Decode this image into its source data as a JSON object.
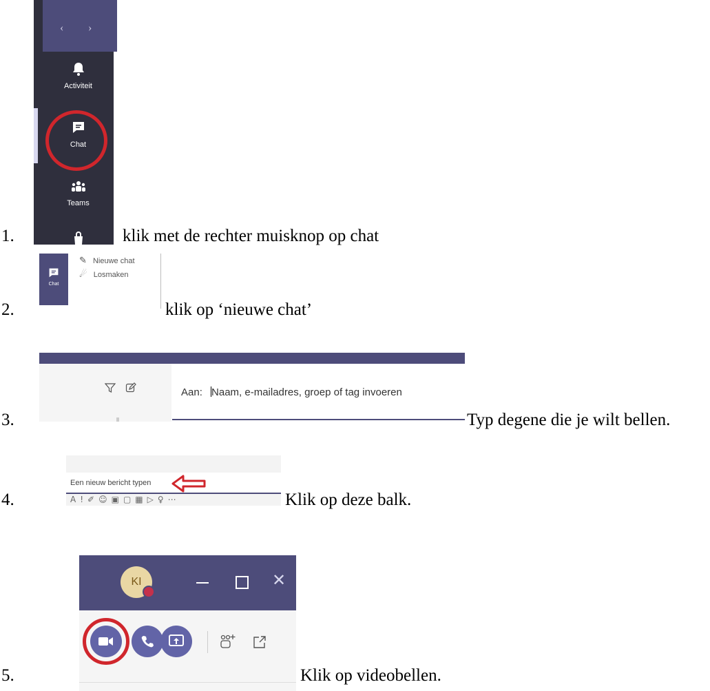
{
  "steps": [
    {
      "number": "1.",
      "text": "klik met de rechter muisknop op chat"
    },
    {
      "number": "2.",
      "text": "klik op ‘nieuwe chat’"
    },
    {
      "number": "3.",
      "text": "Typ degene die je wilt bellen."
    },
    {
      "number": "4.",
      "text": "Klik op deze balk."
    },
    {
      "number": "5.",
      "text": "Klik op videobellen."
    }
  ],
  "shot1": {
    "nav": [
      "Activiteit",
      "Chat",
      "Teams"
    ]
  },
  "shot2": {
    "tile_label": "Chat",
    "menu": [
      "Nieuwe chat",
      "Losmaken"
    ]
  },
  "shot3": {
    "to_label": "Aan:",
    "to_placeholder": "Naam, e-mailadres, groep of tag invoeren"
  },
  "shot4": {
    "placeholder": "Een nieuw bericht typen"
  },
  "shot5": {
    "initials": "KI"
  },
  "colors": {
    "teams_purple": "#4d4c7a",
    "rail_dark": "#2f2f3d",
    "highlight_red": "#d0262c",
    "button_purple": "#6264a7"
  }
}
